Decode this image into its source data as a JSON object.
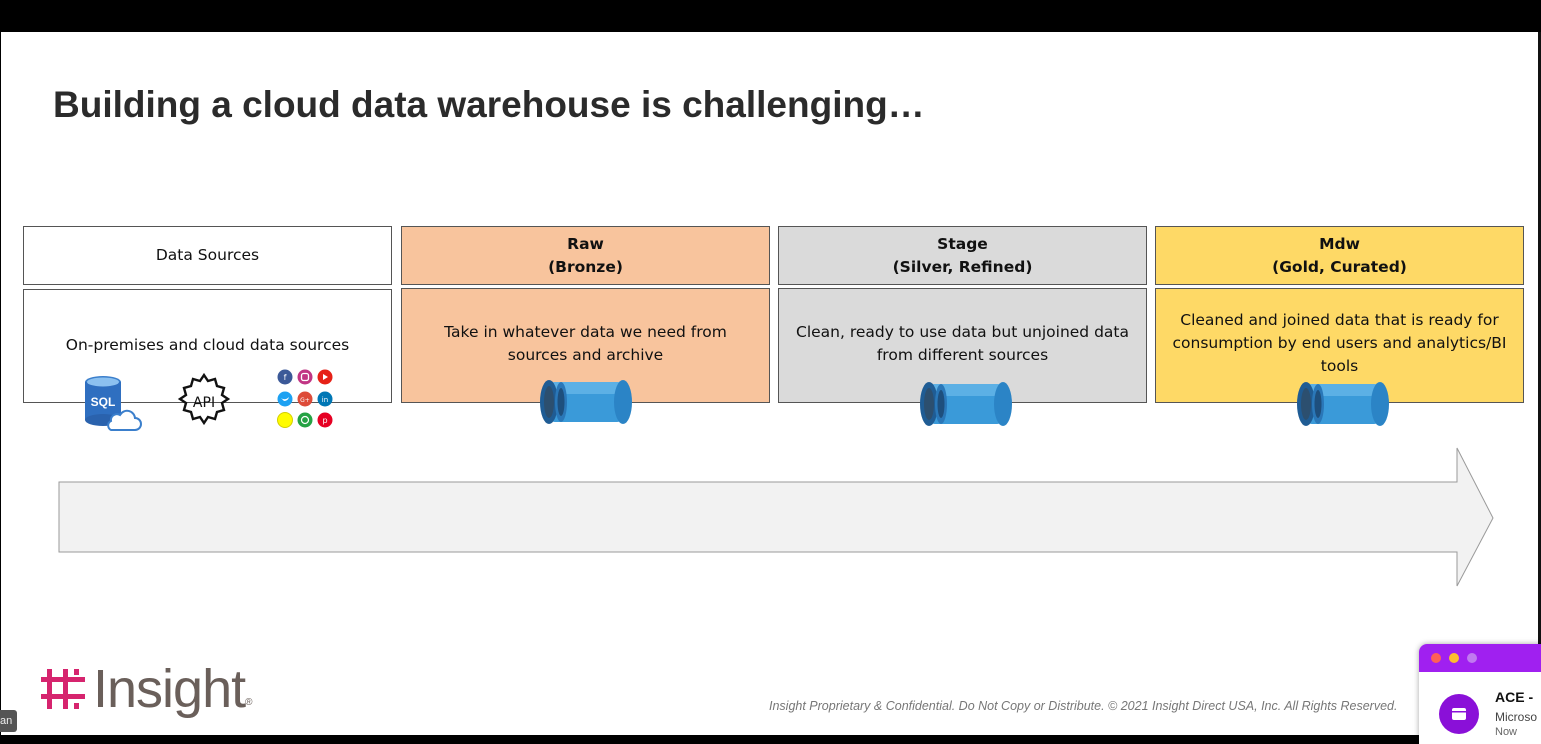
{
  "slide": {
    "title": "Building a cloud data warehouse is challenging…",
    "columns": [
      {
        "header_line1": "Data Sources",
        "header_line2": "",
        "body": "On-premises and cloud data sources",
        "fill": "#ffffff"
      },
      {
        "header_line1": "Raw",
        "header_line2": "(Bronze)",
        "body_line1": "Take in whatever data we need from",
        "body_line2": "sources and archive",
        "fill": "#f8c49d"
      },
      {
        "header_line1": "Stage",
        "header_line2": "(Silver, Refined)",
        "body_line1": "Clean, ready to use data but unjoined data",
        "body_line2": "from different sources",
        "fill": "#dadada"
      },
      {
        "header_line1": "Mdw",
        "header_line2": "(Gold, Curated)",
        "body_line1": "Cleaned and joined data that is ready for",
        "body_line2": "consumption by end users and analytics/BI",
        "body_line3": "tools",
        "fill": "#fed966"
      }
    ],
    "icons": {
      "sql": "SQL",
      "api": "API",
      "social": [
        "facebook-icon",
        "instagram-icon",
        "youtube-icon",
        "twitter-icon",
        "google-plus-icon",
        "linkedin-icon",
        "snapchat-icon",
        "whatsapp-icon",
        "pinterest-icon"
      ],
      "storage": "storage-pipe-icon"
    },
    "footer": "Insight Proprietary & Confidential. Do Not Copy or Distribute. © 2021 Insight Direct USA, Inc. All Rights Reserved.",
    "logo_text": "Insight",
    "logo_mark": "®",
    "colors": {
      "accent": "#d6246e",
      "logo_text": "#6a5f5a",
      "arrow_fill": "#f2f2f2"
    }
  },
  "overlay": {
    "speaker_tag": "an",
    "notification": {
      "title": "ACE -",
      "subtitle": "Microso",
      "time": "Now",
      "bar_color": "#a020f0"
    }
  }
}
